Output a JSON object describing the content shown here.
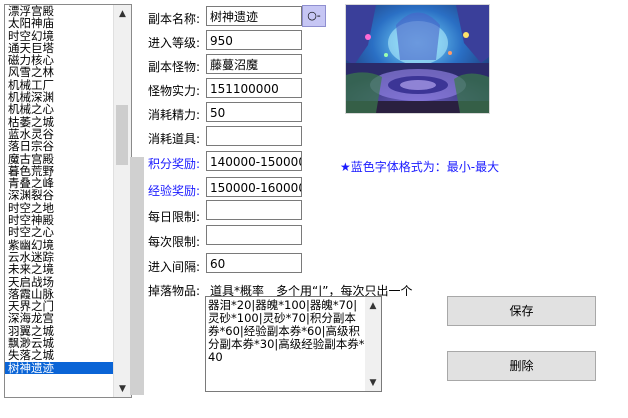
{
  "list": {
    "items": [
      "漂浮宫殿",
      "太阳神庙",
      "时空幻境",
      "通天巨塔",
      "磁力核心",
      "风雪之林",
      "机械工厂",
      "机械深渊",
      "机械之心",
      "枯萎之城",
      "蓝水灵谷",
      "落日宗谷",
      "魔古宫殿",
      "暮色荒野",
      "青叠之峰",
      "深渊裂谷",
      "时空之地",
      "时空神殿",
      "时空之心",
      "紫幽幻境",
      "云水迷踪",
      "未来之境",
      "天启战场",
      "落霞山脉",
      "天界之门",
      "深海龙宫",
      "羽翼之城",
      "飘渺云城",
      "失落之城",
      "树神遗迹"
    ],
    "selected_index": 29
  },
  "form": {
    "name_label": "副本名称:",
    "name_value": "树神遗迹",
    "dropdown_label": "○-",
    "level_label": "进入等级:",
    "level_value": "950",
    "monster_label": "副本怪物:",
    "monster_value": "藤蔓沼魔",
    "power_label": "怪物实力:",
    "power_value": "151100000",
    "energy_label": "消耗精力:",
    "energy_value": "50",
    "item_label": "消耗道具:",
    "item_value": "",
    "points_label": "积分奖励:",
    "points_value": "140000-150000",
    "exp_label": "经验奖励:",
    "exp_value": "150000-160000",
    "daily_label": "每日限制:",
    "daily_value": "",
    "each_label": "每次限制:",
    "each_value": "",
    "interval_label": "进入间隔:",
    "interval_value": "60"
  },
  "note": "★蓝色字体格式为：最小-最大",
  "drops": {
    "label": "掉落物品:",
    "hint": "道具*概率　多个用“|”，每次只出一个",
    "value": "器泪*20|器魄*100|器魄*70|灵砂*100|灵砂*70|积分副本券*60|经验副本券*60|高级积分副本券*30|高级经验副本券*40"
  },
  "buttons": {
    "save": "保存",
    "delete": "删除"
  },
  "colors": {
    "selection": "#0a64d6",
    "blue_label": "#1a1aff",
    "dropdown_button": "#c6c6f4"
  },
  "icons": {
    "scroll_up": "triangle-up-icon",
    "scroll_down": "triangle-down-icon"
  }
}
